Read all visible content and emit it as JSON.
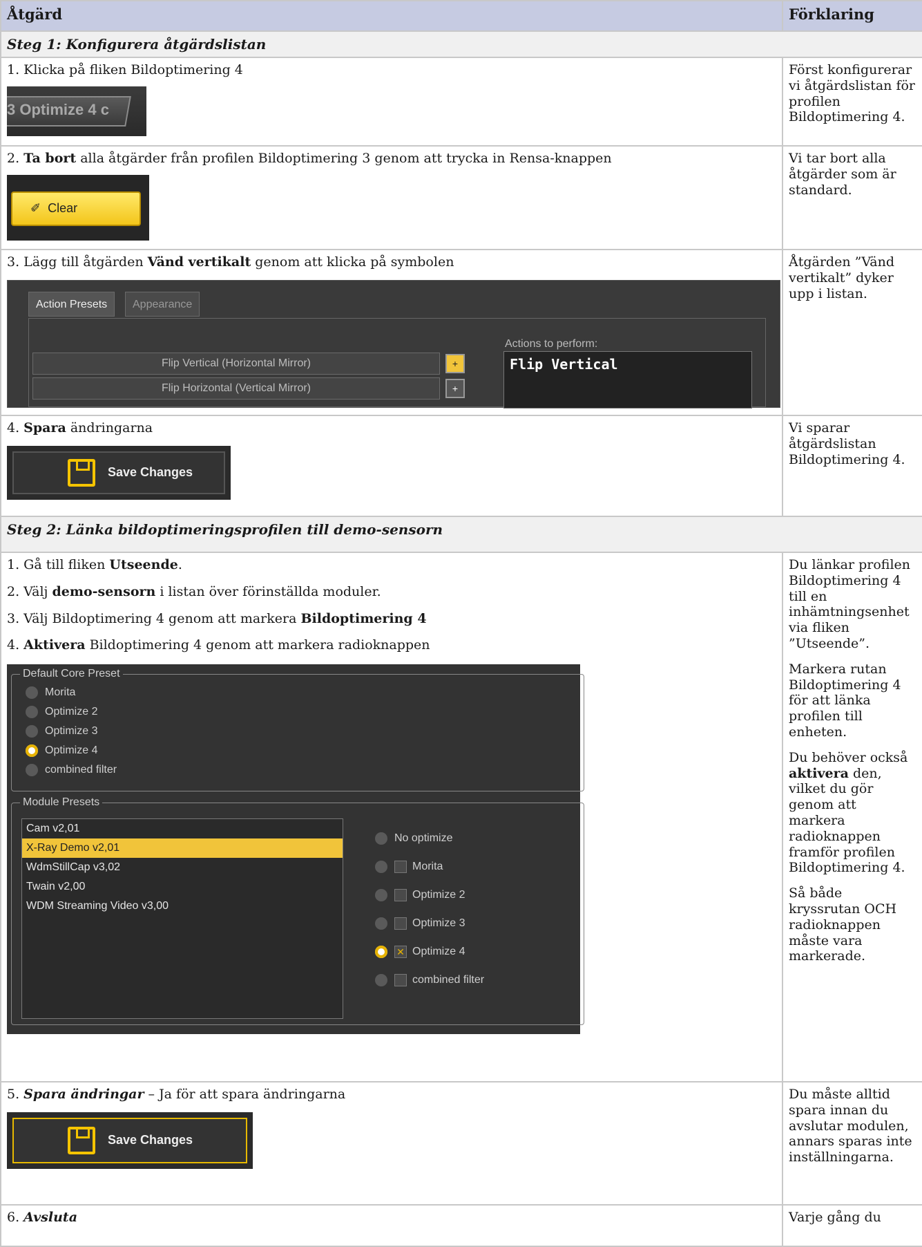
{
  "header": {
    "col_action": "Åtgärd",
    "col_explanation": "Förklaring"
  },
  "step1": {
    "title": "Steg 1: Konfigurera åtgärdslistan",
    "rows": [
      {
        "text": "1. Klicka på fliken Bildoptimering 4",
        "explanation": "Först konfigurerar vi åtgärdslistan för profilen Bildoptimering 4.",
        "ui": {
          "tab_label": "3 Optimize 4 c"
        }
      },
      {
        "pre": "2. ",
        "bold": "Ta bort",
        "post": " alla åtgärder från profilen Bildoptimering 3 genom att trycka in Rensa-knappen",
        "explanation": "Vi tar bort alla åtgärder som är standard.",
        "ui": {
          "button_label": "Clear"
        }
      },
      {
        "pre": "3. Lägg till åtgärden ",
        "bold": "Vänd vertikalt",
        "post": " genom att klicka på symbolen",
        "explanation": "Åtgärden ”Vänd vertikalt” dyker upp i listan.",
        "ui": {
          "tab_action_presets": "Action Presets",
          "tab_appearance": "Appearance",
          "row1": "Flip Vertical (Horizontal Mirror)",
          "row2": "Flip Horizontal (Vertical Mirror)",
          "perform_label": "Actions to perform:",
          "perform_item": "Flip Vertical"
        }
      },
      {
        "pre": "4. ",
        "bold": "Spara",
        "post": " ändringarna",
        "explanation": "Vi sparar åtgärdslistan Bildoptimering 4.",
        "ui": {
          "button_label": "Save Changes"
        }
      }
    ]
  },
  "step2": {
    "title": "Steg 2: Länka bildoptimeringsprofilen till demo-sensorn",
    "instructions": [
      {
        "pre": "1. Gå till fliken ",
        "bold": "Utseende",
        "post": "."
      },
      {
        "pre": "2. Välj ",
        "bold": "demo-sensorn",
        "post": " i listan över förinställda moduler."
      },
      {
        "pre": "3. Välj Bildoptimering 4 genom att markera ",
        "bold": "Bildoptimering 4",
        "post": ""
      },
      {
        "pre": "4. ",
        "bold": "Aktivera",
        "post": " Bildoptimering 4 genom att markera radioknappen"
      }
    ],
    "explanations": {
      "p1": "Du länkar profilen Bildoptimering 4 till en inhämtningsenhet via fliken ”Utseende”.",
      "p2": "Markera rutan Bildoptimering 4 för att länka profilen till enheten.",
      "p3_pre": "Du behöver också ",
      "p3_bold": "aktivera",
      "p3_post": " den, vilket du gör genom att markera radioknappen framför profilen Bildoptimering 4.",
      "p4": "Så både kryssrutan OCH radioknappen måste vara markerade."
    },
    "ui": {
      "core_title": "Default Core Preset",
      "core_options": [
        "Morita",
        "Optimize 2",
        "Optimize 3",
        "Optimize 4",
        "combined filter"
      ],
      "core_selected": 3,
      "module_title": "Module Presets",
      "modules": [
        "Cam v2,01",
        "X-Ray Demo v2,01",
        "WdmStillCap v3,02",
        "Twain v2,00",
        "WDM Streaming Video v3,00"
      ],
      "module_selected": 1,
      "module_options": [
        "No optimize",
        "Morita",
        "Optimize 2",
        "Optimize 3",
        "Optimize 4",
        "combined filter"
      ]
    },
    "save_row": {
      "pre": "5. ",
      "bold_italic": "Spara ändringar",
      "post": " – Ja för att spara ändringarna",
      "explanation": "Du måste alltid spara innan du avslutar modulen, annars sparas inte inställningarna.",
      "button_label": "Save Changes"
    },
    "exit_row": {
      "pre": "6. ",
      "bold_italic": "Avsluta",
      "explanation": "Varje gång du"
    }
  }
}
